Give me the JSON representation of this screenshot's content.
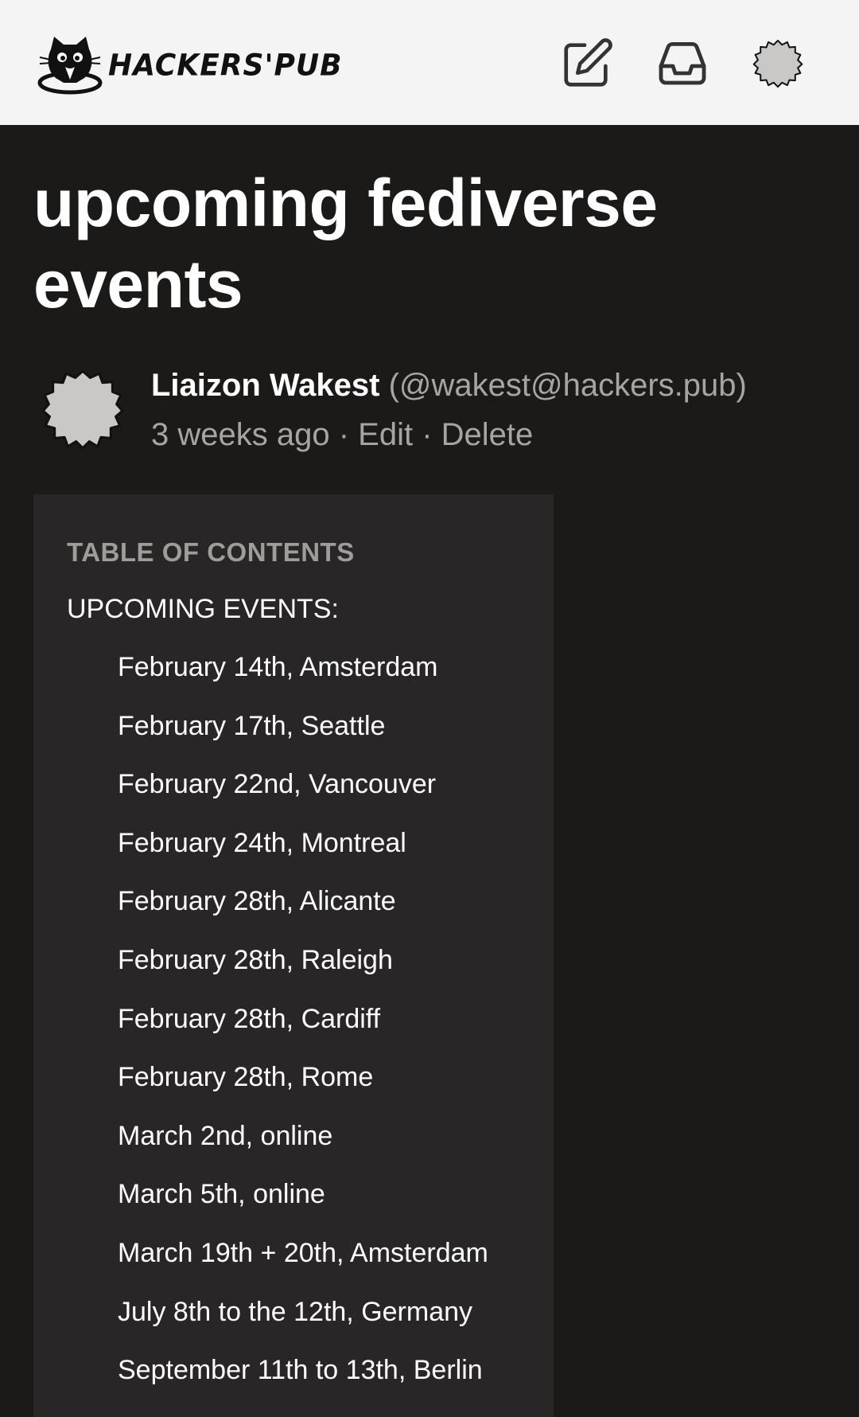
{
  "header": {
    "logo_text": "HACKERS'PUB",
    "icons": [
      "cat-logo-icon",
      "compose-icon",
      "inbox-icon",
      "avatar-icon"
    ]
  },
  "article": {
    "title": "upcoming fediverse events",
    "author_name": "Liaizon Wakest",
    "author_handle": "(@wakest@hackers.pub)",
    "time": "3 weeks ago",
    "separator": " · ",
    "edit_label": "Edit",
    "delete_label": "Delete"
  },
  "toc": {
    "heading": "TABLE OF CONTENTS",
    "group": "UPCOMING EVENTS:",
    "items": [
      "February 14th, Amsterdam",
      "February 17th, Seattle",
      "February 22nd, Vancouver",
      "February 24th, Montreal",
      "February 28th, Alicante",
      "February 28th, Raleigh",
      "February 28th, Cardiff",
      "February 28th, Rome",
      "March 2nd, online",
      "March 5th, online",
      "March 19th + 20th, Amsterdam",
      "July 8th to the 12th, Germany",
      "September 11th to 13th, Berlin"
    ]
  },
  "colors": {
    "header_bg": "#f4f4f4",
    "page_bg": "#1c1a19",
    "toc_bg": "#292627",
    "muted_text": "#a9a4a1"
  }
}
